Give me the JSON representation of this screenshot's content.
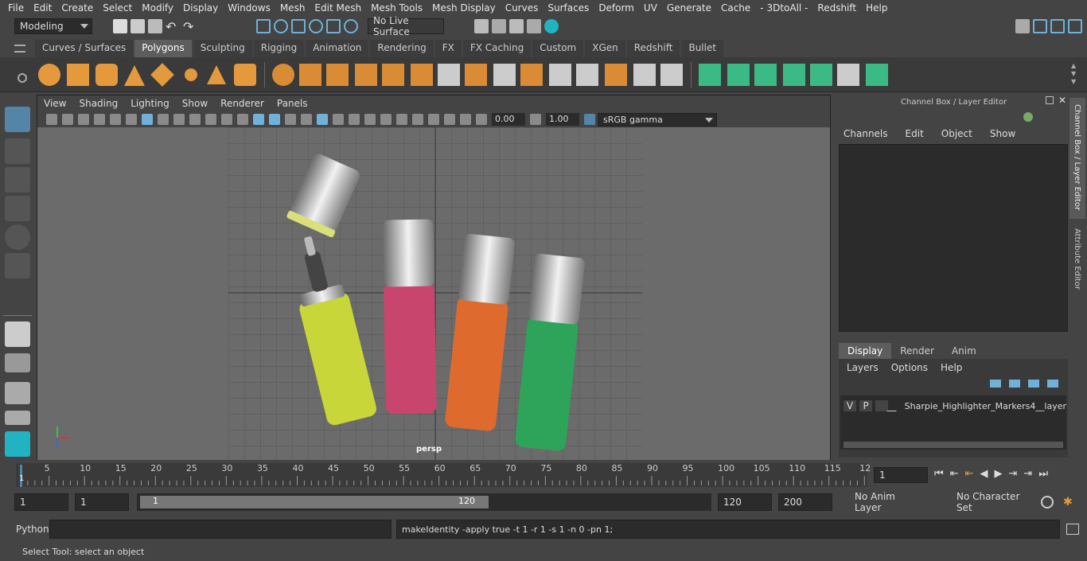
{
  "menubar": [
    "File",
    "Edit",
    "Create",
    "Select",
    "Modify",
    "Display",
    "Windows",
    "Mesh",
    "Edit Mesh",
    "Mesh Tools",
    "Mesh Display",
    "Curves",
    "Surfaces",
    "Deform",
    "UV",
    "Generate",
    "Cache",
    "- 3DtoAll -",
    "Redshift",
    "Help"
  ],
  "status": {
    "mode": "Modeling",
    "live_surface": "No Live Surface"
  },
  "shelf_tabs": [
    "Curves / Surfaces",
    "Polygons",
    "Sculpting",
    "Rigging",
    "Animation",
    "Rendering",
    "FX",
    "FX Caching",
    "Custom",
    "XGen",
    "Redshift",
    "Bullet"
  ],
  "shelf_active": "Polygons",
  "viewport": {
    "menu": [
      "View",
      "Shading",
      "Lighting",
      "Show",
      "Renderer",
      "Panels"
    ],
    "exposure": "0.00",
    "gamma": "1.00",
    "color_space": "sRGB gamma",
    "camera": "persp"
  },
  "right_panel": {
    "title": "Channel Box / Layer Editor",
    "channel_menu": [
      "Channels",
      "Edit",
      "Object",
      "Show"
    ],
    "layer_tabs": [
      "Display",
      "Render",
      "Anim"
    ],
    "layer_menu": [
      "Layers",
      "Options",
      "Help"
    ],
    "layer": {
      "v": "V",
      "p": "P",
      "name": "Sharpie_Highlighter_Markers4__layer"
    },
    "side_tabs": [
      "Channel Box / Layer Editor",
      "Attribute Editor"
    ]
  },
  "timeline": {
    "ticks": [
      "5",
      "10",
      "15",
      "20",
      "25",
      "30",
      "35",
      "40",
      "45",
      "50",
      "55",
      "60",
      "65",
      "70",
      "75",
      "80",
      "85",
      "90",
      "95",
      "100",
      "105",
      "110",
      "115",
      "12"
    ],
    "start_marker": "1",
    "current_frame": "1"
  },
  "range": {
    "start": "1",
    "start2": "1",
    "slider_start": "1",
    "slider_end": "120",
    "end": "120",
    "end2": "200",
    "anim_layer": "No Anim Layer",
    "char_set": "No Character Set"
  },
  "cmdline": {
    "lang": "Python",
    "output": "makeIdentity -apply true -t 1 -r 1 -s 1 -n 0 -pn 1;"
  },
  "helpline": "Select Tool: select an object",
  "colors": {
    "accent": "#5285a6",
    "marker_yellow": "#c9d63a",
    "marker_pink": "#c8456e",
    "marker_orange": "#de6a2e",
    "marker_green": "#2ea35a",
    "maya_teal": "#21b3c1"
  }
}
